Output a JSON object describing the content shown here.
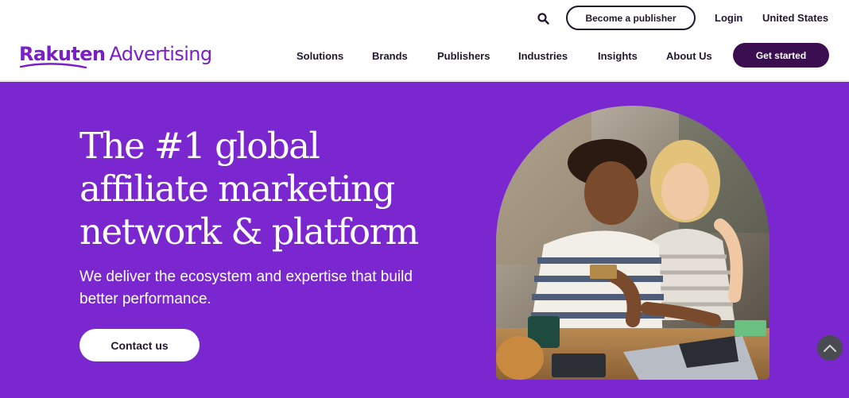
{
  "header": {
    "logo": {
      "brand": "Rakuten",
      "product": "Advertising"
    },
    "topbar": {
      "search_icon": "search-icon",
      "publisher_button": "Become a publisher",
      "login": "Login",
      "region": "United States"
    },
    "nav": {
      "items": [
        {
          "label": "Solutions"
        },
        {
          "label": "Brands"
        },
        {
          "label": "Publishers"
        },
        {
          "label": "Industries"
        },
        {
          "label": "Insights"
        },
        {
          "label": "About Us"
        }
      ],
      "cta": "Get started"
    }
  },
  "hero": {
    "title_lines": [
      "The #1 global",
      "affiliate marketing",
      "network & platform"
    ],
    "subtitle": "We deliver the ecosystem and expertise that build better performance.",
    "cta": "Contact us",
    "image_description_icon": "photo"
  },
  "scroll_top": {
    "icon": "chevron-up-icon"
  },
  "colors": {
    "brand_purple": "#7b27d0",
    "logo_purple": "#7a1fc8",
    "dark_button": "#3a0e4f",
    "text": "#22172e"
  }
}
